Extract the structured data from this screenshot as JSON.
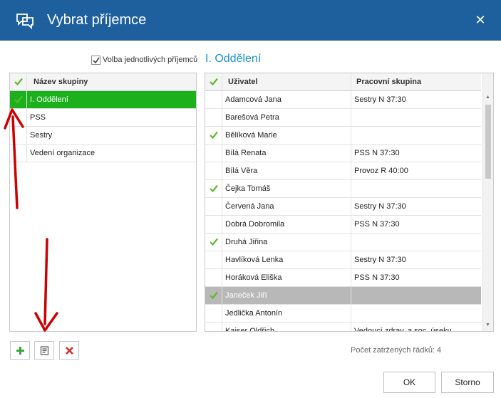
{
  "window": {
    "title": "Vybrat příjemce",
    "icon": "chat-bubbles-icon",
    "close_glyph": "✕"
  },
  "option": {
    "label": "Volba jednotlivých příjemců",
    "checked": true
  },
  "department_heading": "I. Oddělení",
  "groups": {
    "header": "Název skupiny",
    "rows": [
      {
        "name": "I. Oddělení",
        "checked": true,
        "selected": true
      },
      {
        "name": "PSS",
        "checked": false,
        "selected": false
      },
      {
        "name": "Sestry",
        "checked": false,
        "selected": false
      },
      {
        "name": "Vedení organizace",
        "checked": false,
        "selected": false
      }
    ]
  },
  "users": {
    "header_user": "Uživatel",
    "header_group": "Pracovní skupina",
    "rows": [
      {
        "user": "Adamcová Jana",
        "group": "Sestry N 37:30",
        "checked": false,
        "grey": false
      },
      {
        "user": "Barešová Petra",
        "group": "",
        "checked": false,
        "grey": false
      },
      {
        "user": "Bělíková Marie",
        "group": "",
        "checked": true,
        "grey": false
      },
      {
        "user": "Bílá Renata",
        "group": "PSS N 37:30",
        "checked": false,
        "grey": false
      },
      {
        "user": "Bílá Věra",
        "group": "Provoz R 40:00",
        "checked": false,
        "grey": false
      },
      {
        "user": "Čejka Tomáš",
        "group": "",
        "checked": true,
        "grey": false
      },
      {
        "user": "Červená Jana",
        "group": "Sestry N 37:30",
        "checked": false,
        "grey": false
      },
      {
        "user": "Dobrá Dobromila",
        "group": "PSS N 37:30",
        "checked": false,
        "grey": false
      },
      {
        "user": "Druhá Jiřina",
        "group": "",
        "checked": true,
        "grey": false
      },
      {
        "user": "Havlíková Lenka",
        "group": "Sestry N 37:30",
        "checked": false,
        "grey": false
      },
      {
        "user": "Horáková Eliška",
        "group": "PSS N 37:30",
        "checked": false,
        "grey": false
      },
      {
        "user": "Janeček Jiří",
        "group": "",
        "checked": true,
        "grey": true
      },
      {
        "user": "Jedlička Antonín",
        "group": "",
        "checked": false,
        "grey": false
      },
      {
        "user": "Kaiser Oldřich",
        "group": "Vedoucí zdrav. a soc. úseku",
        "checked": false,
        "grey": false
      }
    ]
  },
  "toolbar": {
    "add_icon": "plus-icon",
    "edit_icon": "edit-list-icon",
    "delete_icon": "delete-x-icon"
  },
  "status": {
    "label": "Počet zatržených řádků:",
    "count": "4"
  },
  "buttons": {
    "ok": "OK",
    "cancel": "Storno"
  },
  "colors": {
    "titlebar": "#1e5f9e",
    "selected_row": "#1cb11c",
    "check": "#5cb82e",
    "heading": "#1a8fcf",
    "annotation_arrow": "#cc0000"
  }
}
